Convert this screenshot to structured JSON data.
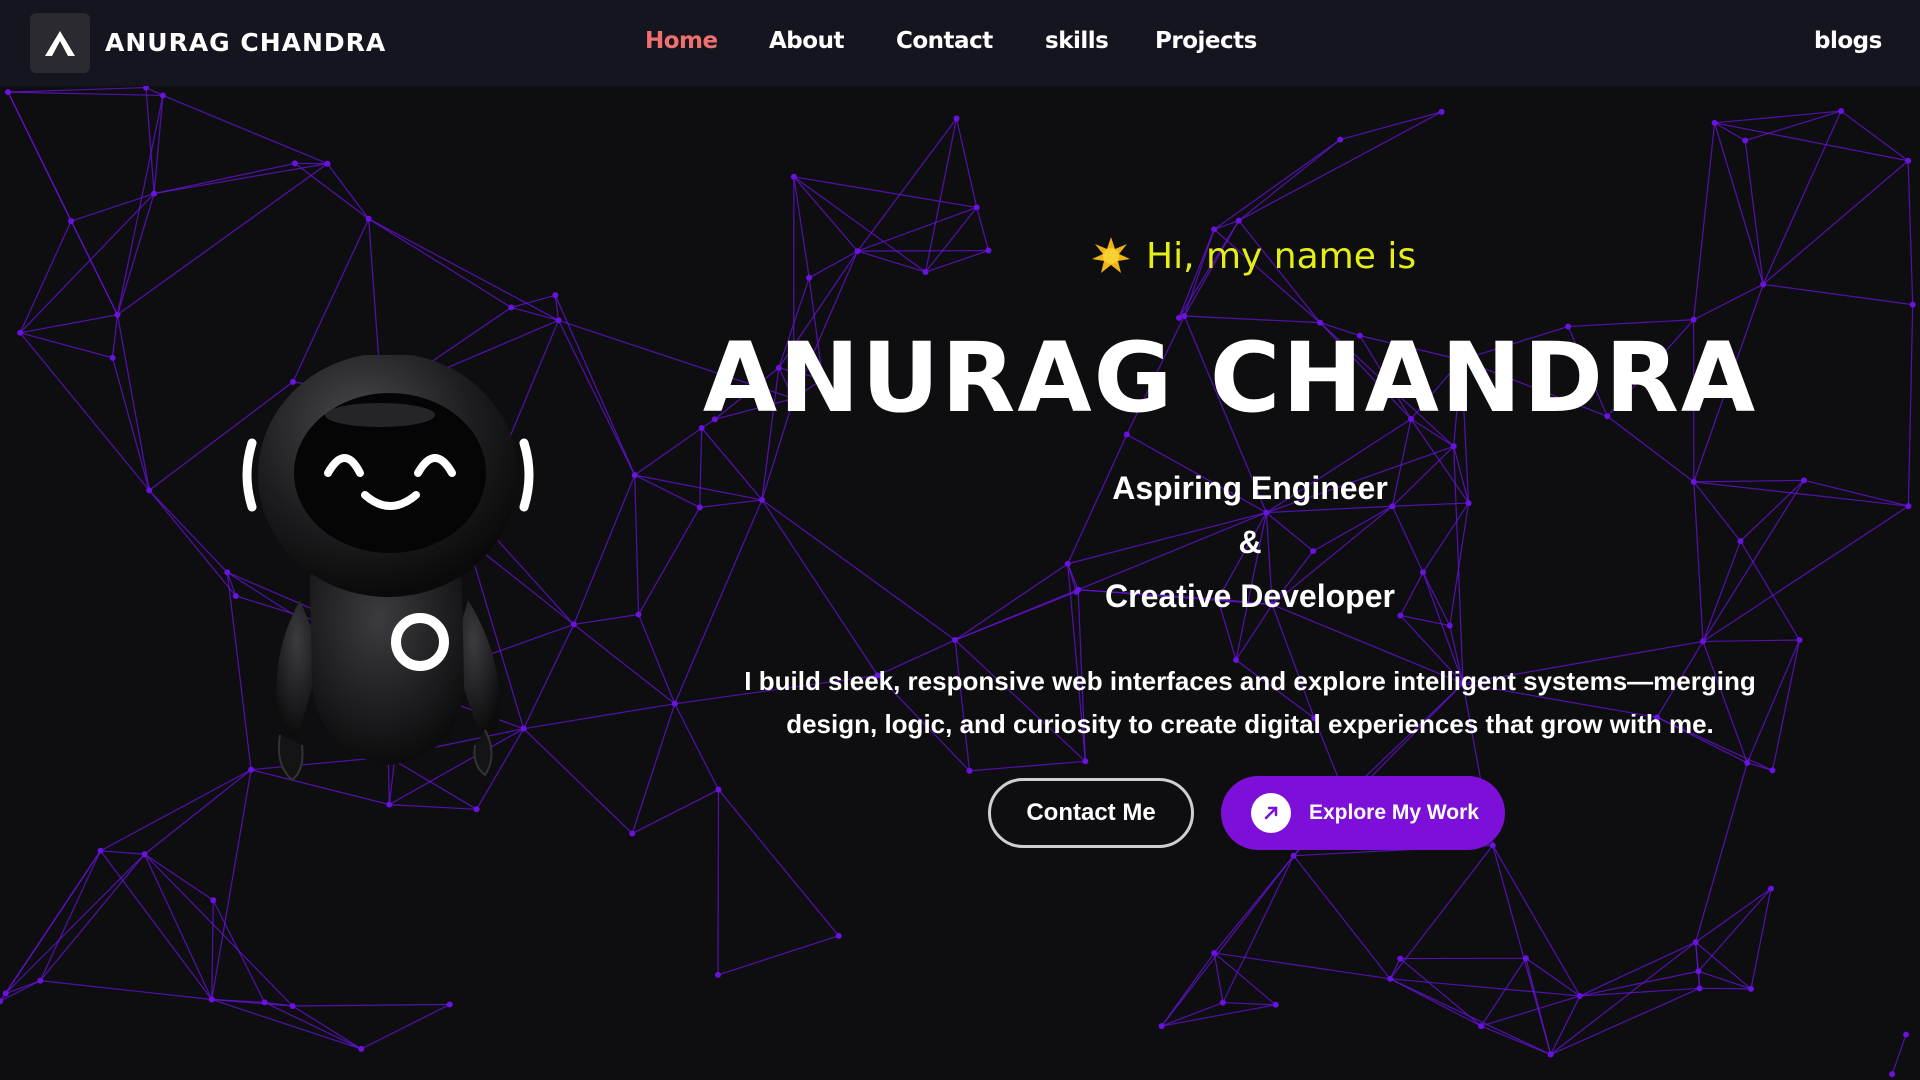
{
  "brand": {
    "name": "ANURAG CHANDRA",
    "logo_icon": "a-letter-logo-icon"
  },
  "nav": {
    "items": [
      {
        "label": "Home",
        "active": true
      },
      {
        "label": "About",
        "active": false
      },
      {
        "label": "Contact",
        "active": false
      },
      {
        "label": "skills",
        "active": false
      },
      {
        "label": "Projects",
        "active": false
      }
    ],
    "blogs_label": "blogs"
  },
  "hero": {
    "greeting_icon": "sparkle-sun-icon",
    "greeting": "Hi, my name is",
    "name": "ANURAG CHANDRA",
    "role_line1": "Aspiring Engineer",
    "role_amp": "&",
    "role_line2": "Creative Developer",
    "description": "I build sleek, responsive web interfaces and explore intelligent systems—merging design, logic, and curiosity to create digital experiences that grow with me.",
    "contact_button": "Contact Me",
    "explore_button": "Explore My Work",
    "explore_icon": "arrow-up-right-icon",
    "mascot": "robot-mascot"
  },
  "colors": {
    "background": "#0e0e10",
    "navbar": "#15151f",
    "accent_purple": "#7c10d8",
    "network_lines": "#6a12e0",
    "active_nav": "#f07070",
    "greeting": "#e4f012"
  }
}
